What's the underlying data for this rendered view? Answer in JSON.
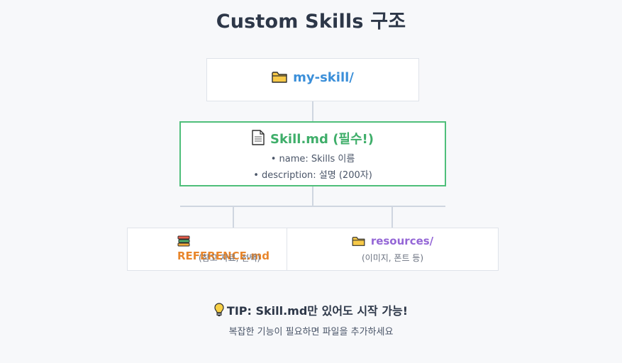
{
  "title": "Custom Skills 구조",
  "root": {
    "icon": "folder-icon",
    "label": "my-skill/"
  },
  "skill_file": {
    "icon": "document-icon",
    "label": "Skill.md (필수!)",
    "fields": [
      "• name: Skills 이름",
      "• description: 설명 (200자)"
    ],
    "border_color": "#4fbf7a"
  },
  "children": [
    {
      "icon": "books-icon",
      "label": "REFERENCE.md",
      "sub": "(참고 자료, 선택)",
      "color": "#e8862c"
    },
    {
      "icon": "folder-icon",
      "label": "resources/",
      "sub": "(이미지, 폰트 등)",
      "color": "#9466d6"
    }
  ],
  "tip": {
    "icon": "lightbulb-icon",
    "text": "TIP: Skill.md만 있어도 시작 가능!",
    "subtext": "복잡한 기능이 필요하면 파일을 추가하세요"
  }
}
